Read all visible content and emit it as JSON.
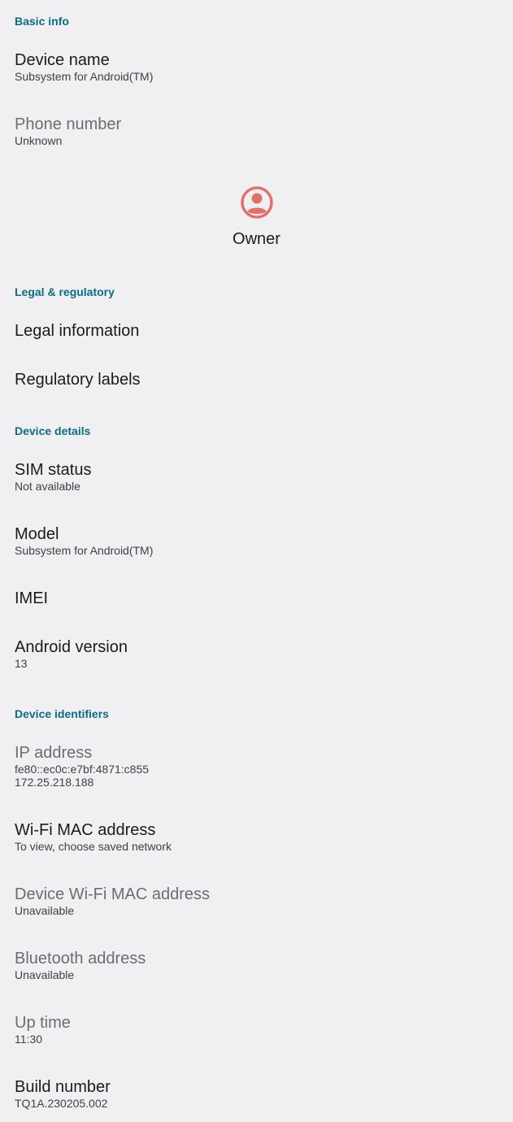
{
  "sections": {
    "basic_info": "Basic info",
    "legal": "Legal & regulatory",
    "device_details": "Device details",
    "device_identifiers": "Device identifiers"
  },
  "items": {
    "device_name": {
      "title": "Device name",
      "summary": "Subsystem for Android(TM)"
    },
    "phone_number": {
      "title": "Phone number",
      "summary": "Unknown"
    },
    "legal_information": {
      "title": "Legal information"
    },
    "regulatory_labels": {
      "title": "Regulatory labels"
    },
    "sim_status": {
      "title": "SIM status",
      "summary": "Not available"
    },
    "model": {
      "title": "Model",
      "summary": "Subsystem for Android(TM)"
    },
    "imei": {
      "title": "IMEI"
    },
    "android_version": {
      "title": "Android version",
      "summary": "13"
    },
    "ip_address": {
      "title": "IP address",
      "summary_lines": [
        "fe80::ec0c:e7bf:4871:c855",
        "172.25.218.188"
      ]
    },
    "wifi_mac": {
      "title": "Wi-Fi MAC address",
      "summary": "To view, choose saved network"
    },
    "device_wifi_mac": {
      "title": "Device Wi-Fi MAC address",
      "summary": "Unavailable"
    },
    "bluetooth_address": {
      "title": "Bluetooth address",
      "summary": "Unavailable"
    },
    "up_time": {
      "title": "Up time",
      "summary": "11:30"
    },
    "build_number": {
      "title": "Build number",
      "summary": "TQ1A.230205.002"
    }
  },
  "owner": {
    "label": "Owner",
    "icon": "account-circle-icon",
    "icon_color": "#e2716b"
  },
  "colors": {
    "accent": "#0e6b85",
    "background": "#f0f0f3"
  }
}
